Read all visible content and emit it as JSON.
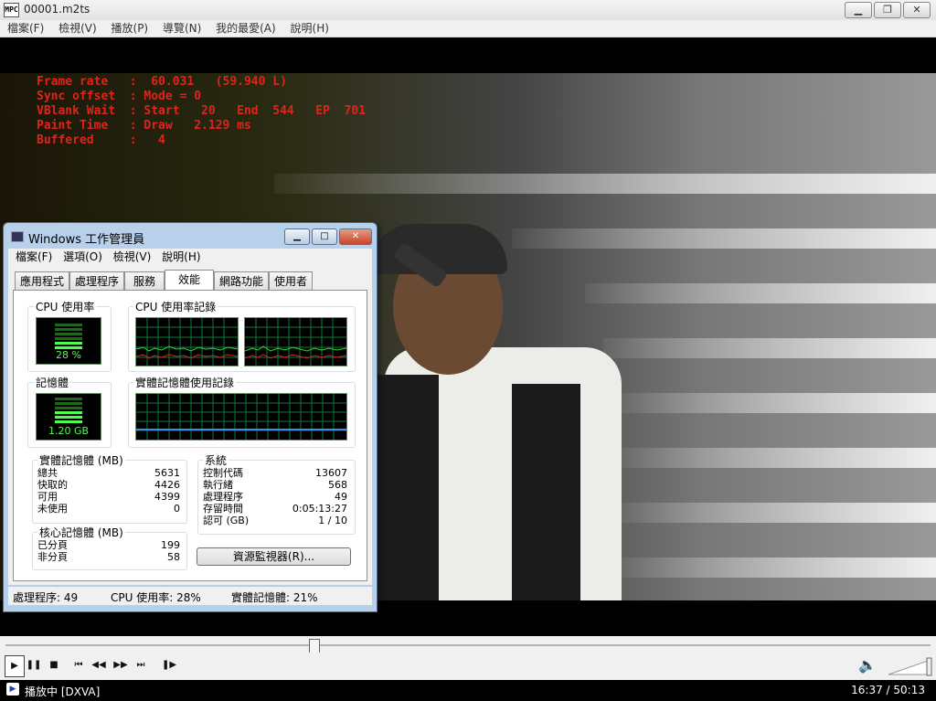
{
  "player": {
    "title": "00001.m2ts",
    "icon_label": "MPC",
    "window_buttons": {
      "minimize": "▁",
      "restore": "❐",
      "close": "✕"
    },
    "menu": [
      "檔案(F)",
      "檢視(V)",
      "播放(P)",
      "導覽(N)",
      "我的最愛(A)",
      "說明(H)"
    ],
    "osd": {
      "line1": "Frame rate   :  60.031   (59.940 L)",
      "line2": "Sync offset  : Mode = 0",
      "line3": "VBlank Wait  : Start   20   End  544   EP  701",
      "line4": "Paint Time   : Draw   2.129 ms",
      "line5": "Buffered     :   4"
    },
    "seek_position": 0.334,
    "controls": {
      "play": "▶",
      "pause": "❚❚",
      "stop": "■",
      "prev": "⏮",
      "rewind": "◀◀",
      "forward": "▶▶",
      "next": "⏭",
      "frame_step": "❚▶",
      "volume": "🔈"
    },
    "status": "播放中 [DXVA]",
    "time": "16:37 / 50:13"
  },
  "taskmgr": {
    "title": "Windows 工作管理員",
    "menu": [
      "檔案(F)",
      "選項(O)",
      "檢視(V)",
      "說明(H)"
    ],
    "tabs": [
      "應用程式",
      "處理程序",
      "服務",
      "效能",
      "網路功能",
      "使用者"
    ],
    "active_tab": "效能",
    "cpu_usage_label": "CPU 使用率",
    "cpu_history_label": "CPU 使用率記錄",
    "cpu_value": "28 %",
    "mem_label": "記憶體",
    "mem_history_label": "實體記憶體使用記錄",
    "mem_value": "1.20 GB",
    "physical": {
      "header": "實體記憶體 (MB)",
      "rows": [
        {
          "label": "總共",
          "value": "5631"
        },
        {
          "label": "快取的",
          "value": "4426"
        },
        {
          "label": "可用",
          "value": "4399"
        },
        {
          "label": "未使用",
          "value": "0"
        }
      ]
    },
    "kernel": {
      "header": "核心記憶體 (MB)",
      "rows": [
        {
          "label": "已分頁",
          "value": "199"
        },
        {
          "label": "非分頁",
          "value": "58"
        }
      ]
    },
    "system": {
      "header": "系統",
      "rows": [
        {
          "label": "控制代碼",
          "value": "13607"
        },
        {
          "label": "執行緒",
          "value": "568"
        },
        {
          "label": "處理程序",
          "value": "49"
        },
        {
          "label": "存留時間",
          "value": "0:05:13:27"
        },
        {
          "label": "認可 (GB)",
          "value": "1 / 10"
        }
      ]
    },
    "resmon_button": "資源監視器(R)...",
    "status": {
      "processes": "處理程序: 49",
      "cpu": "CPU 使用率: 28%",
      "memory": "實體記憶體: 21%"
    },
    "colors": {
      "graph_grid": "#0a7a3a",
      "cpu_line": "#30d830",
      "kernel_line": "#e02020",
      "mem_line": "#3a8fe0",
      "meter": "#4cff4c"
    }
  }
}
